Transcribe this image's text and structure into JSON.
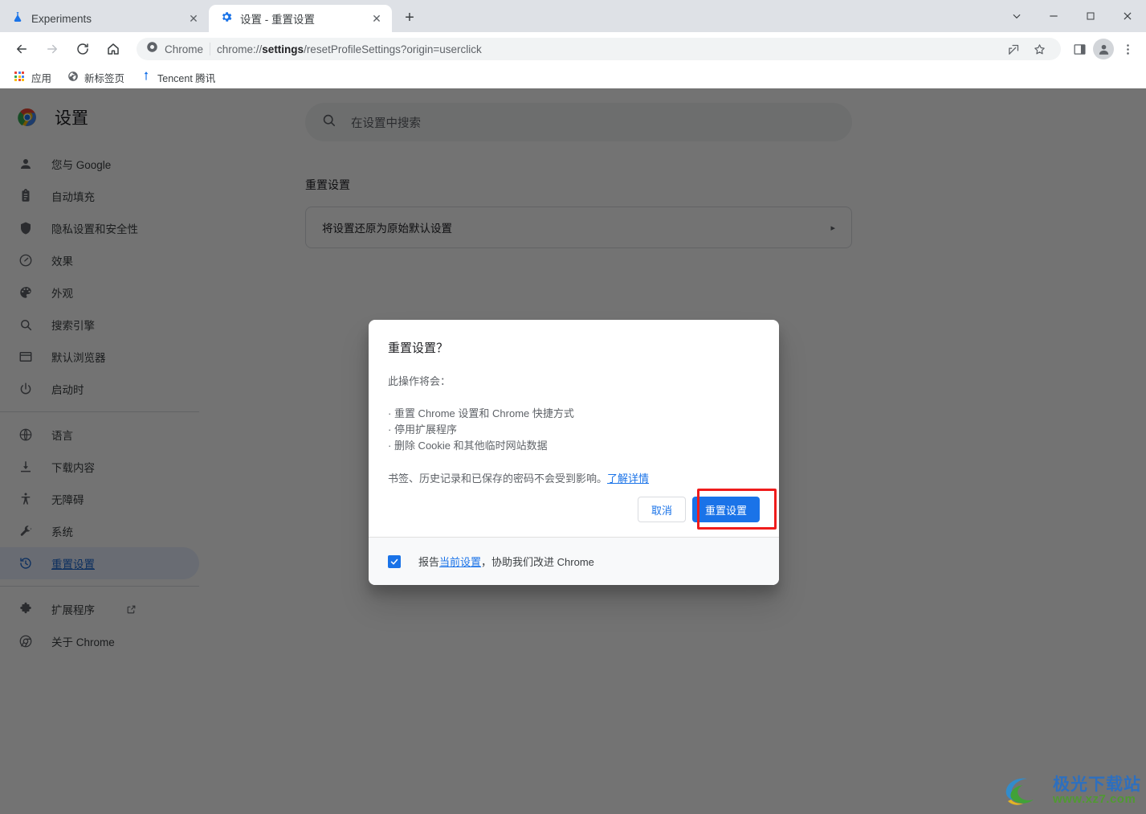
{
  "window": {
    "controls": [
      {
        "name": "tab-search-button",
        "glyph": "⌄"
      },
      {
        "name": "minimize-button",
        "glyph": "–"
      },
      {
        "name": "maximize-button",
        "glyph": "☐"
      },
      {
        "name": "close-button",
        "glyph": "✕"
      }
    ]
  },
  "tabs": [
    {
      "title": "Experiments",
      "icon": "flask-icon",
      "active": false,
      "close_label": "✕"
    },
    {
      "title": "设置 - 重置设置",
      "icon": "gear-icon",
      "active": true,
      "close_label": "✕"
    }
  ],
  "new_tab_label": "+",
  "toolbar": {
    "back_label": "←",
    "forward_label": "→",
    "reload_label": "↻",
    "home_label": "⌂",
    "omnibox": {
      "chip": "Chrome",
      "url_prefix": "chrome://",
      "url_bold": "settings",
      "url_suffix": "/resetProfileSettings?origin=userclick",
      "full_url": "chrome://settings/resetProfileSettings?origin=userclick"
    },
    "actions": [
      {
        "name": "share-icon"
      },
      {
        "name": "bookmark-star-icon"
      },
      {
        "name": "side-panel-icon"
      },
      {
        "name": "profile-avatar"
      },
      {
        "name": "more-menu-icon"
      }
    ]
  },
  "bookmarks": [
    {
      "label": "应用",
      "icon": "apps-grid-icon"
    },
    {
      "label": "新标签页",
      "icon": "globe-icon"
    },
    {
      "label": "Tencent 腾讯",
      "icon": "tencent-icon"
    }
  ],
  "sidebar": {
    "title": "设置",
    "logo": "chrome-logo",
    "group1": [
      {
        "label": "您与 Google",
        "icon": "person-icon"
      },
      {
        "label": "自动填充",
        "icon": "clipboard-icon"
      },
      {
        "label": "隐私设置和安全性",
        "icon": "shield-icon"
      },
      {
        "label": "效果",
        "icon": "speedometer-icon"
      },
      {
        "label": "外观",
        "icon": "palette-icon"
      },
      {
        "label": "搜索引擎",
        "icon": "search-icon"
      },
      {
        "label": "默认浏览器",
        "icon": "browser-window-icon"
      },
      {
        "label": "启动时",
        "icon": "power-icon"
      }
    ],
    "group2": [
      {
        "label": "语言",
        "icon": "globe-icon"
      },
      {
        "label": "下载内容",
        "icon": "download-icon"
      },
      {
        "label": "无障碍",
        "icon": "accessibility-icon"
      },
      {
        "label": "系统",
        "icon": "wrench-icon"
      },
      {
        "label": "重置设置",
        "icon": "restore-clock-icon",
        "selected": true
      }
    ],
    "group3": [
      {
        "label": "扩展程序",
        "icon": "puzzle-icon",
        "external": true
      },
      {
        "label": "关于 Chrome",
        "icon": "chrome-outline-icon"
      }
    ]
  },
  "main": {
    "search_placeholder": "在设置中搜索",
    "search_icon": "search-icon",
    "section_title": "重置设置",
    "card_label": "将设置还原为原始默认设置",
    "card_chevron": "▸"
  },
  "dialog": {
    "title": "重置设置？",
    "intro": "此操作将会：",
    "bullets": [
      "· 重置 Chrome 设置和 Chrome 快捷方式",
      "· 停用扩展程序",
      "· 删除 Cookie 和其他临时网站数据"
    ],
    "note_text": "书签、历史记录和已保存的密码不会受到影响。",
    "note_link": "了解详情",
    "cancel_label": "取消",
    "confirm_label": "重置设置",
    "checkbox_checked": true,
    "checkbox_prefix": "报告",
    "checkbox_link": "当前设置",
    "checkbox_suffix": "，协助我们改进 Chrome",
    "highlight_color": "#ef1c1c",
    "primary_color": "#1a73e8"
  },
  "watermark": {
    "cn": "极光下载站",
    "en": "www.xz7.com"
  }
}
